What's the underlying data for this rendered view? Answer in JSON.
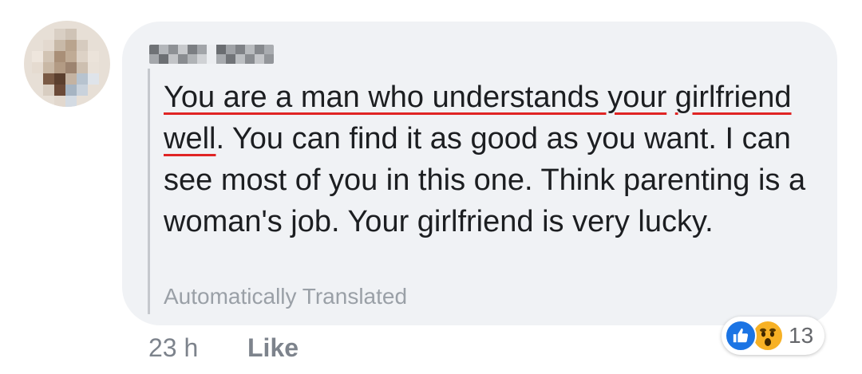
{
  "comment": {
    "author_redacted": true,
    "text": {
      "part1": "You are a man who understands your",
      "part2": "girlfriend well",
      "part3": ". You can find it as good as you want. I can see most of you in this one. Think parenting is a woman's job. Your girlfriend is very lucky."
    },
    "translation_note": "Automatically Translated",
    "time": "23 h",
    "like_label": "Like",
    "reactions": {
      "icons": [
        "like-icon",
        "wow-icon"
      ],
      "count": "13"
    }
  },
  "colors": {
    "bubble": "#f0f2f5",
    "text": "#1c1e21",
    "muted": "#7d838c",
    "underline": "#e02424",
    "like_blue": "#1b74e4",
    "wow_yellow": "#f7b125"
  }
}
